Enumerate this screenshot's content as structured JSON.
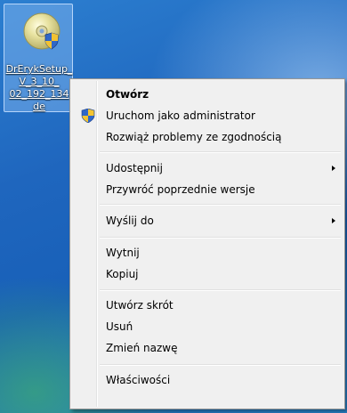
{
  "desktop": {
    "file_icon": {
      "label_lines": [
        "DrErykSetup_V_3_10_",
        "02_192_134",
        "de"
      ]
    }
  },
  "context_menu": {
    "items": [
      {
        "label": "Otwórz",
        "bold": true
      },
      {
        "label": "Uruchom jako administrator",
        "icon": "uac-shield-icon"
      },
      {
        "label": "Rozwiąż problemy ze zgodnością"
      },
      {
        "label": "Udostępnij",
        "submenu": true
      },
      {
        "label": "Przywróć poprzednie wersje"
      },
      {
        "label": "Wyślij do",
        "submenu": true
      },
      {
        "label": "Wytnij"
      },
      {
        "label": "Kopiuj"
      },
      {
        "label": "Utwórz skrót"
      },
      {
        "label": "Usuń"
      },
      {
        "label": "Zmień nazwę"
      },
      {
        "label": "Właściwości"
      }
    ]
  }
}
